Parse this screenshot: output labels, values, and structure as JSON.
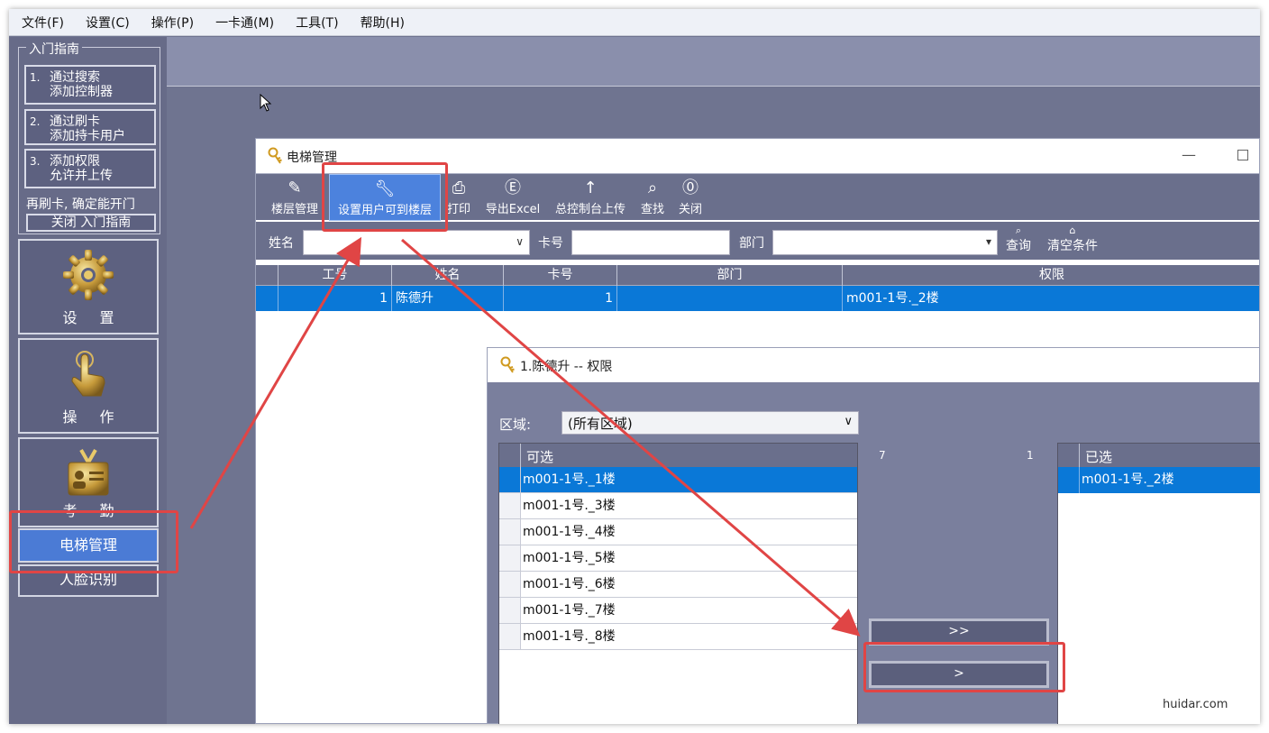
{
  "menubar": {
    "items": [
      "文件(F)",
      "设置(C)",
      "操作(P)",
      "一卡通(M)",
      "工具(T)",
      "帮助(H)"
    ]
  },
  "guide": {
    "title": "入门指南",
    "steps": [
      {
        "num": "1.",
        "line1": "通过搜索",
        "line2": "添加控制器"
      },
      {
        "num": "2.",
        "line1": "通过刷卡",
        "line2": "添加持卡用户"
      },
      {
        "num": "3.",
        "line1": "添加权限",
        "line2": "允许并上传"
      }
    ],
    "note": "再刷卡, 确定能开门",
    "close_label": "关闭 入门指南"
  },
  "nav": {
    "settings_label": "设 置",
    "operation_label": "操 作",
    "attendance_label": "考 勤",
    "elevator_label": "电梯管理",
    "face_label": "人脸识别"
  },
  "elevator_window": {
    "title": "电梯管理",
    "minimize": "—",
    "toolbar": [
      {
        "label": "楼层管理",
        "icon": "edit-icon"
      },
      {
        "label": "设置用户可到楼层",
        "icon": "wrench-icon"
      },
      {
        "label": "打印",
        "icon": "printer-icon"
      },
      {
        "label": "导出Excel",
        "icon": "excel-icon"
      },
      {
        "label": "总控制台上传",
        "icon": "upload-icon"
      },
      {
        "label": "查找",
        "icon": "search-icon"
      },
      {
        "label": "关闭",
        "icon": "close-icon"
      }
    ],
    "filter": {
      "name_label": "姓名",
      "name_value": "",
      "card_label": "卡号",
      "card_value": "",
      "dept_label": "部门",
      "dept_value": "",
      "query_label": "查询",
      "clear_label": "清空条件"
    },
    "grid": {
      "columns": [
        "工号",
        "姓名",
        "卡号",
        "部门",
        "权限"
      ],
      "rows": [
        {
          "id": "1",
          "name": "陈德升",
          "card": "1",
          "dept": "",
          "perm": "m001-1号._2楼"
        }
      ]
    }
  },
  "permission_dialog": {
    "title": "1.陈德升 -- 权限",
    "region_label": "区域:",
    "region_value": "(所有区域)",
    "available_header": "可选",
    "available_count": "7",
    "available_items": [
      "m001-1号._1楼",
      "m001-1号._3楼",
      "m001-1号._4楼",
      "m001-1号._5楼",
      "m001-1号._6楼",
      "m001-1号._7楼",
      "m001-1号._8楼"
    ],
    "selected_header": "已选",
    "selected_count": "1",
    "selected_items": [
      "m001-1号._2楼"
    ],
    "move_all_label": ">>",
    "move_one_label": ">"
  },
  "watermark": "huidar.com",
  "colors": {
    "selection_blue": "#0a78d7",
    "annotation_red": "#e04545",
    "panel_bg": "#6f7490"
  }
}
